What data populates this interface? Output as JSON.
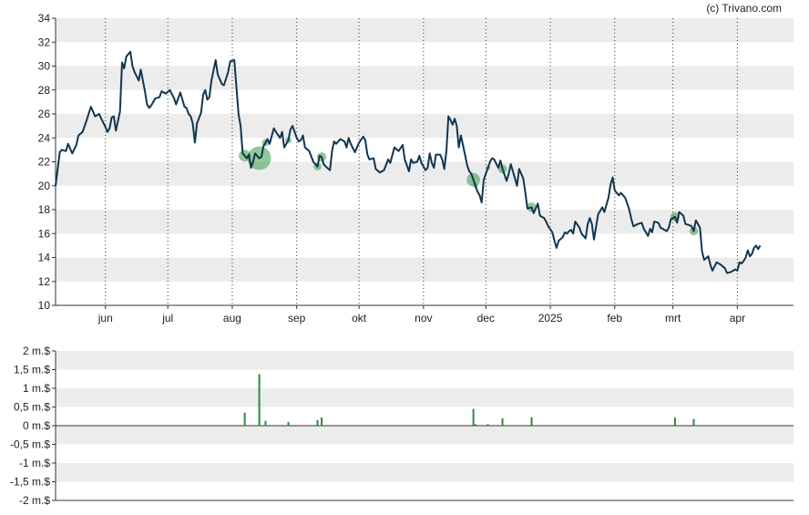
{
  "credit": "(c) Trivano.com",
  "colors": {
    "price_line": "#12364f",
    "volume_bar": "#2e8b3a",
    "band": "#ececec",
    "marker": "#3a9a4a"
  },
  "chart_data": [
    {
      "type": "line",
      "title": "",
      "xlabel": "",
      "ylabel": "",
      "ylim": [
        10,
        34
      ],
      "yticks": [
        "34",
        "32",
        "30",
        "28",
        "26",
        "24",
        "22",
        "20",
        "18",
        "16",
        "14",
        "12",
        "10"
      ],
      "xticks": [
        {
          "label": "jun",
          "day": 24
        },
        {
          "label": "jul",
          "day": 54
        },
        {
          "label": "aug",
          "day": 85
        },
        {
          "label": "sep",
          "day": 116
        },
        {
          "label": "okt",
          "day": 146
        },
        {
          "label": "nov",
          "day": 177
        },
        {
          "label": "dec",
          "day": 207
        },
        {
          "label": "2025",
          "day": 238
        },
        {
          "label": "feb",
          "day": 269
        },
        {
          "label": "mrt",
          "day": 297
        },
        {
          "label": "apr",
          "day": 328
        }
      ],
      "x_range_days": [
        0,
        355
      ],
      "grid": "vertical dotted at month ticks, alternating horizontal bands",
      "series": [
        {
          "days": [
            0,
            2,
            3,
            5,
            6,
            8,
            10,
            11,
            13,
            15,
            17,
            19,
            21,
            22,
            24,
            25,
            26,
            27,
            28,
            29,
            31,
            32,
            33,
            34,
            36,
            37,
            38,
            40,
            41,
            43,
            44,
            45,
            46,
            47,
            48,
            50,
            51,
            53,
            55,
            57,
            58,
            60,
            62,
            63,
            64,
            65,
            66,
            67,
            68,
            70,
            71,
            72,
            73,
            74,
            75,
            77,
            78,
            80,
            81,
            83,
            84,
            86,
            88,
            89,
            90,
            92,
            93,
            94,
            95,
            96,
            98,
            99,
            100,
            102,
            103,
            105,
            106,
            108,
            109,
            110,
            112,
            113,
            114,
            116,
            117,
            118,
            119,
            120,
            122,
            124,
            125,
            126,
            127,
            128,
            129,
            130,
            132,
            133,
            134,
            135,
            137,
            139,
            140,
            141,
            142,
            144,
            146,
            148,
            149,
            150,
            151,
            153,
            154,
            156,
            158,
            160,
            161,
            163,
            165,
            167,
            168,
            169,
            170,
            171,
            172,
            174,
            175,
            176,
            178,
            179,
            180,
            181,
            182,
            183,
            185,
            186,
            187,
            188,
            189,
            190,
            191,
            192,
            193,
            194,
            195,
            196,
            198,
            199,
            200,
            202,
            203,
            204,
            205,
            206,
            208,
            209,
            210,
            211,
            213,
            214,
            215,
            217,
            218,
            219,
            220,
            222,
            223,
            225,
            226,
            227,
            229,
            230,
            232,
            233,
            235,
            236,
            237,
            239,
            240,
            241,
            242,
            244,
            245,
            246,
            247,
            248,
            249,
            250,
            252,
            253,
            255,
            256,
            257,
            258,
            259,
            261,
            263,
            264,
            265,
            266,
            267,
            268,
            269,
            271,
            272,
            274,
            275,
            276,
            277,
            278,
            280,
            282,
            283,
            285,
            286,
            287,
            288,
            290,
            291,
            292,
            294,
            295,
            296,
            298,
            299,
            300,
            302,
            303,
            305,
            306,
            307,
            308,
            310,
            311,
            312,
            314,
            315,
            316,
            318,
            320,
            322,
            323,
            325,
            326,
            327,
            328,
            329,
            330,
            331,
            332,
            333,
            334,
            335,
            336,
            337,
            338,
            339,
            340,
            342,
            343,
            344,
            346,
            347,
            348,
            350,
            351,
            353
          ],
          "values": [
            20.0,
            22.8,
            23.0,
            22.9,
            23.5,
            22.7,
            23.4,
            24.2,
            24.5,
            25.5,
            26.6,
            25.8,
            26.0,
            25.6,
            24.9,
            24.5,
            24.8,
            25.7,
            25.8,
            24.6,
            26.2,
            30.3,
            29.8,
            30.8,
            31.2,
            30.0,
            29.5,
            28.8,
            29.7,
            27.9,
            26.8,
            26.5,
            26.7,
            27.0,
            27.3,
            27.4,
            27.9,
            27.7,
            28.0,
            27.3,
            26.8,
            27.8,
            26.6,
            26.5,
            26.0,
            25.8,
            25.2,
            23.6,
            25.2,
            26.1,
            27.6,
            28.0,
            27.2,
            27.4,
            28.8,
            30.5,
            29.3,
            28.5,
            28.4,
            29.5,
            30.4,
            30.5,
            26.0,
            25.0,
            22.7,
            22.3,
            22.6,
            21.5,
            22.0,
            22.7,
            22.3,
            22.4,
            23.3,
            23.9,
            23.5,
            24.8,
            24.5,
            24.0,
            24.5,
            23.2,
            23.8,
            24.7,
            25.0,
            24.0,
            23.7,
            23.8,
            24.2,
            23.2,
            22.9,
            22.0,
            21.8,
            21.6,
            22.5,
            22.4,
            21.8,
            21.6,
            21.3,
            22.9,
            23.7,
            23.5,
            23.9,
            23.7,
            23.2,
            24.0,
            23.5,
            22.8,
            23.6,
            24.1,
            23.8,
            22.6,
            22.2,
            22.3,
            21.4,
            21.1,
            21.3,
            22.2,
            21.9,
            23.2,
            22.9,
            23.4,
            22.2,
            21.7,
            21.2,
            22.2,
            21.9,
            22.0,
            22.5,
            21.9,
            21.3,
            21.5,
            22.7,
            21.9,
            21.5,
            22.6,
            22.6,
            22.2,
            21.4,
            22.9,
            25.8,
            25.5,
            25.1,
            25.6,
            25.0,
            23.2,
            24.2,
            23.4,
            21.7,
            21.2,
            21.0,
            20.0,
            19.5,
            19.2,
            18.6,
            20.5,
            21.5,
            22.0,
            22.3,
            22.2,
            21.5,
            22.1,
            21.4,
            20.4,
            21.0,
            21.8,
            21.2,
            20.0,
            21.4,
            20.6,
            19.4,
            18.1,
            18.2,
            17.7,
            18.5,
            17.5,
            17.3,
            17.0,
            16.6,
            16.1,
            15.4,
            14.8,
            15.4,
            15.7,
            16.1,
            16.0,
            16.2,
            16.3,
            16.0,
            17.0,
            16.5,
            16.0,
            15.6,
            16.8,
            17.3,
            16.8,
            15.5,
            17.6,
            18.2,
            17.8,
            18.4,
            19.0,
            20.1,
            20.7,
            19.6,
            19.2,
            19.4,
            19.0,
            18.5,
            18.0,
            17.2,
            16.6,
            16.8,
            16.9,
            16.4,
            15.8,
            16.4,
            16.1,
            17.0,
            16.9,
            16.5,
            16.4,
            16.2,
            16.5,
            17.2,
            17.4,
            16.9,
            17.8,
            17.5,
            16.8,
            16.7,
            16.6,
            16.2,
            17.1,
            16.5,
            14.5,
            13.8,
            14.1,
            13.4,
            12.9,
            13.6,
            13.4,
            13.1,
            12.7,
            12.8,
            12.9,
            13.0,
            12.9,
            13.6,
            13.5,
            13.7,
            14.0,
            14.6,
            14.1,
            14.3,
            14.8,
            15.0,
            14.7,
            15.0
          ]
        }
      ]
    },
    {
      "type": "bar",
      "title": "",
      "ylim": [
        -2,
        2
      ],
      "yticks": [
        "2 m.$",
        "1,5 m.$",
        "1 m.$",
        "0,5 m.$",
        "0 m.$",
        "-0,5 m.$",
        "-1 m.$",
        "-1,5 m.$",
        "-2 m.$"
      ],
      "series": [
        {
          "days": [
            91,
            98,
            101,
            112,
            126,
            128,
            201,
            202,
            208,
            215,
            229,
            298,
            307
          ],
          "values": [
            0.35,
            1.38,
            0.13,
            0.1,
            0.15,
            0.22,
            0.45,
            0.04,
            0.04,
            0.2,
            0.23,
            0.22,
            0.18
          ]
        }
      ]
    }
  ]
}
